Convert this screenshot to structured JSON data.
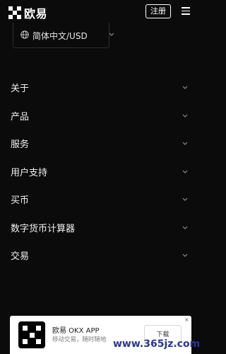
{
  "header": {
    "brand": "欧易",
    "register_label": "注册"
  },
  "language_selector": {
    "value": "简体中文/USD"
  },
  "nav": {
    "items": [
      {
        "label": "关于"
      },
      {
        "label": "产品"
      },
      {
        "label": "服务"
      },
      {
        "label": "用户支持"
      },
      {
        "label": "买币"
      },
      {
        "label": "数字货币计算器"
      },
      {
        "label": "交易"
      }
    ]
  },
  "app_banner": {
    "title": "欧易 OKX APP",
    "subtitle": "移动交易，随时随地",
    "download_label": "下载",
    "close_glyph": "×"
  },
  "watermark": {
    "text": "www.365jz.com"
  },
  "colors": {
    "background": "#0b0b0b",
    "text": "#ffffff",
    "divider": "#2e2e2e",
    "banner_bg": "#ffffff",
    "watermark": "#2a3a8f"
  },
  "icons": [
    "okx-logo-icon",
    "hamburger-menu-icon",
    "globe-icon",
    "chevron-down-icon",
    "close-icon"
  ]
}
